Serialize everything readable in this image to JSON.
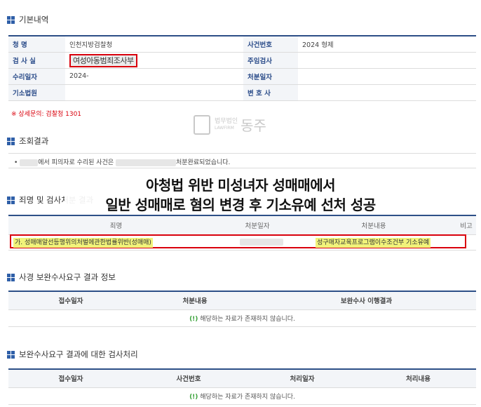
{
  "basic": {
    "title": "기본내역",
    "rows": [
      {
        "l1": "청 명",
        "v1": "인천지방검찰청",
        "l2": "사건번호",
        "v2": "2024 형제"
      },
      {
        "l1": "검 사 실",
        "v1": "여성아동범죄조사부",
        "l2": "주임검사",
        "v2": ""
      },
      {
        "l1": "수리일자",
        "v1": "2024-",
        "l2": "처분일자",
        "v2": ""
      },
      {
        "l1": "기소법원",
        "v1": "",
        "l2": "변 호 사",
        "v2": ""
      }
    ],
    "notice": "※ 상세문의: 검찰청 1301"
  },
  "watermark": {
    "small1": "법무법인",
    "small2": "LAWFIRM",
    "big": "동주"
  },
  "result": {
    "title": "조회결과",
    "text_a": "에서 피의자로 수리된 사건은",
    "text_b": "처분완료되었습니다."
  },
  "charge": {
    "title": "죄명 및 검사처분 결과",
    "headers": [
      "죄명",
      "처분일자",
      "처분내용",
      "비고"
    ],
    "row": {
      "name": "가. 성매매알선등행위의처벌에관한법률위반(성매매)",
      "disposition": "성구매자교육프로그램이수조건부 기소유예"
    }
  },
  "caption": {
    "line1": "아청법 위반 미성녀자 성매매에서",
    "line2": "일반 성매매로 혐의 변경 후 기소유예 선처 성공"
  },
  "supp1": {
    "title": "사경 보완수사요구 결과 정보",
    "headers": [
      "접수일자",
      "처분내용",
      "보완수사 이행결과"
    ],
    "empty_mark": "(!)",
    "empty": "해당하는 자료가 존재하지 않습니다."
  },
  "supp2": {
    "title": "보완수사요구 결과에 대한 검사처리",
    "headers": [
      "접수일자",
      "사건번호",
      "처리일자",
      "처리내용"
    ],
    "empty_mark": "(!)",
    "empty": "해당하는 자료가 존재하지 않습니다."
  },
  "colors": {
    "accent": "#2f5fa8",
    "red": "#d9000c",
    "highlight": "#f1f37a"
  }
}
